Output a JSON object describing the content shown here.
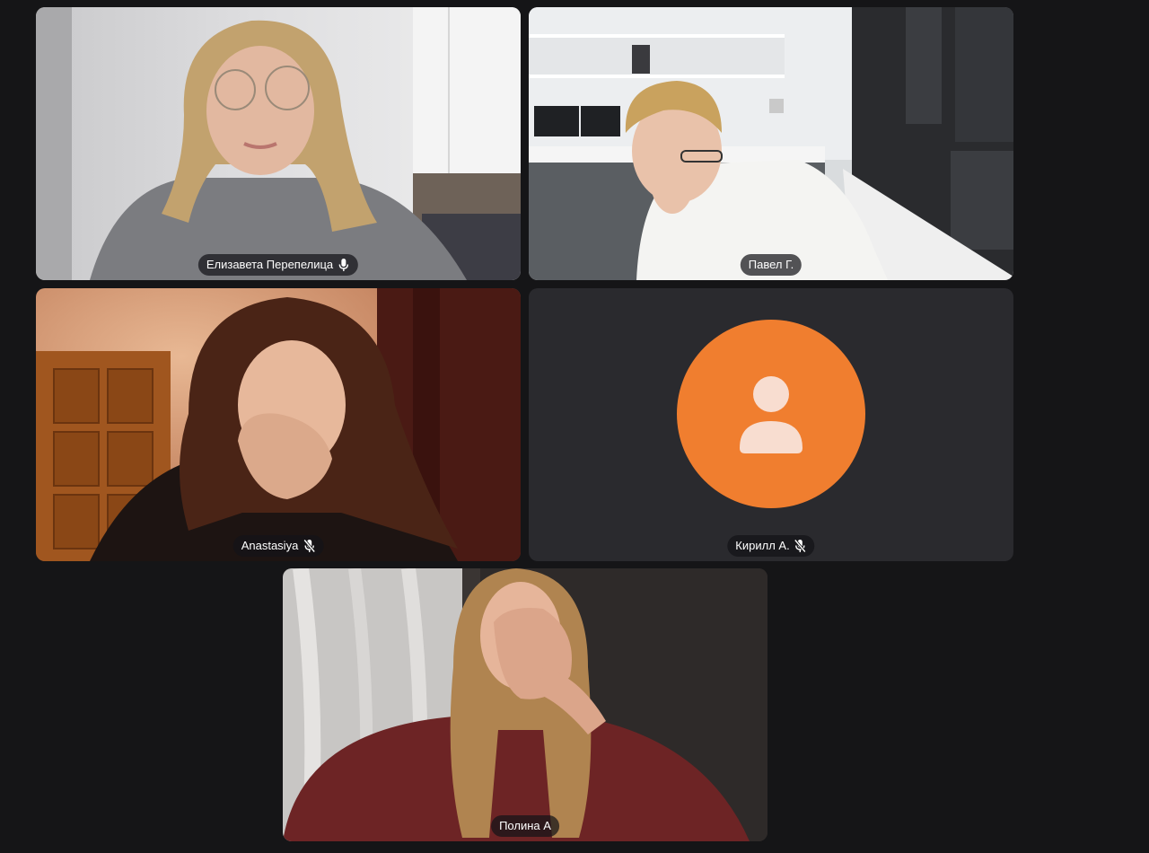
{
  "theme": {
    "background": "#151517",
    "empty_tile": "#2a2a2e",
    "avatar_color": "#f07e2f",
    "tag_background": "rgba(20,20,24,0.72)"
  },
  "participants": [
    {
      "name": "Елизавета Перепелица",
      "mic_icon": "mic-icon",
      "muted": false,
      "video": true
    },
    {
      "name": "Павел Г.",
      "mic_icon": null,
      "muted": false,
      "video": true
    },
    {
      "name": "Anastasiya",
      "mic_icon": "mic-off-icon",
      "muted": true,
      "video": true
    },
    {
      "name": "Кирилл А.",
      "mic_icon": "mic-off-icon",
      "muted": true,
      "video": false,
      "avatar_icon": "user-avatar-icon"
    },
    {
      "name": "Полина А",
      "mic_icon": null,
      "muted": false,
      "video": true
    }
  ]
}
